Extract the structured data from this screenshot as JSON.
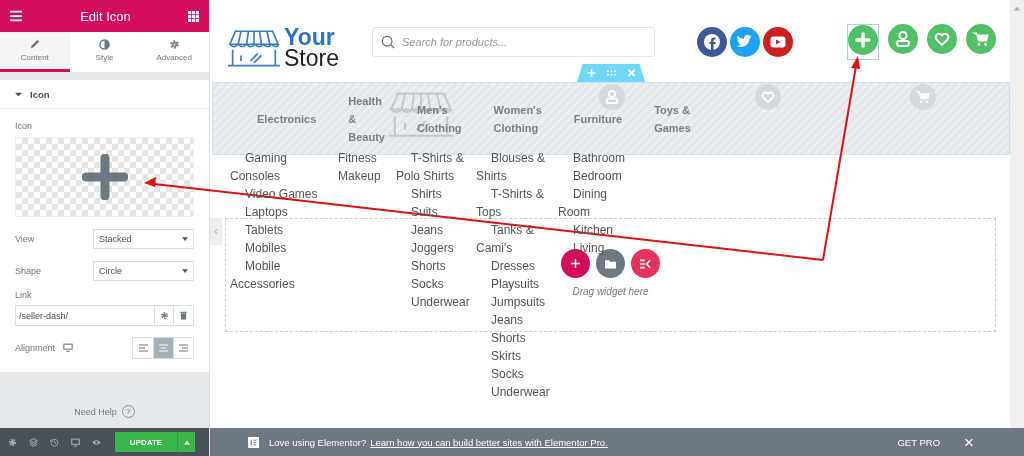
{
  "editor_panel": {
    "title": "Edit Icon",
    "tabs": [
      {
        "label": "Content",
        "selected": true
      },
      {
        "label": "Style",
        "selected": false
      },
      {
        "label": "Advanced",
        "selected": false
      }
    ],
    "section": {
      "title": "Icon",
      "expanded": true
    },
    "icon_label": "Icon",
    "view": {
      "label": "View",
      "value": "Stacked"
    },
    "shape": {
      "label": "Shape",
      "value": "Circle"
    },
    "link": {
      "label": "Link",
      "value": "/seller-dash/"
    },
    "alignment": {
      "label": "Alignment",
      "options": [
        {
          "selected": false
        },
        {
          "selected": true
        },
        {
          "selected": false
        }
      ]
    },
    "need_help": "Need Help",
    "help_mark": "?",
    "update_button": "UPDATE"
  },
  "site_header": {
    "logo": {
      "line1": "Your",
      "line2": "Store"
    },
    "search": {
      "placeholder": "Search for products..."
    }
  },
  "nav": {
    "items": [
      "Electronics",
      "Health & Beauty",
      "Men's Clothing",
      "Women's Clothing",
      "Furniture",
      "Toys & Games"
    ]
  },
  "submenus": [
    [
      "Gaming Consoles",
      "Video Games",
      "Laptops",
      "Tablets",
      "Mobiles",
      "Mobile Accessories"
    ],
    [
      "Fitness",
      "Makeup"
    ],
    [
      "T-Shirts & Polo Shirts",
      "Shirts",
      "Suits",
      "Jeans",
      "Joggers",
      "Shorts",
      "Socks",
      "Underwear"
    ],
    [
      "Blouses & Shirts",
      "T-Shirts & Tops",
      "Tanks & Cami's",
      "Dresses",
      "Playsuits",
      "Jumpsuits",
      "Jeans",
      "Shorts",
      "Skirts",
      "Socks",
      "Underwear"
    ],
    [
      "Bathroom",
      "Bedroom",
      "Dining Room",
      "Kitchen",
      "Living"
    ]
  ],
  "drop_zone": {
    "hint": "Drag widget here"
  },
  "notice_bar": {
    "text": "Love using Elementor?",
    "link": "Learn how you can build better sites with Elementor Pro.",
    "action": "GET PRO",
    "close": "×"
  }
}
